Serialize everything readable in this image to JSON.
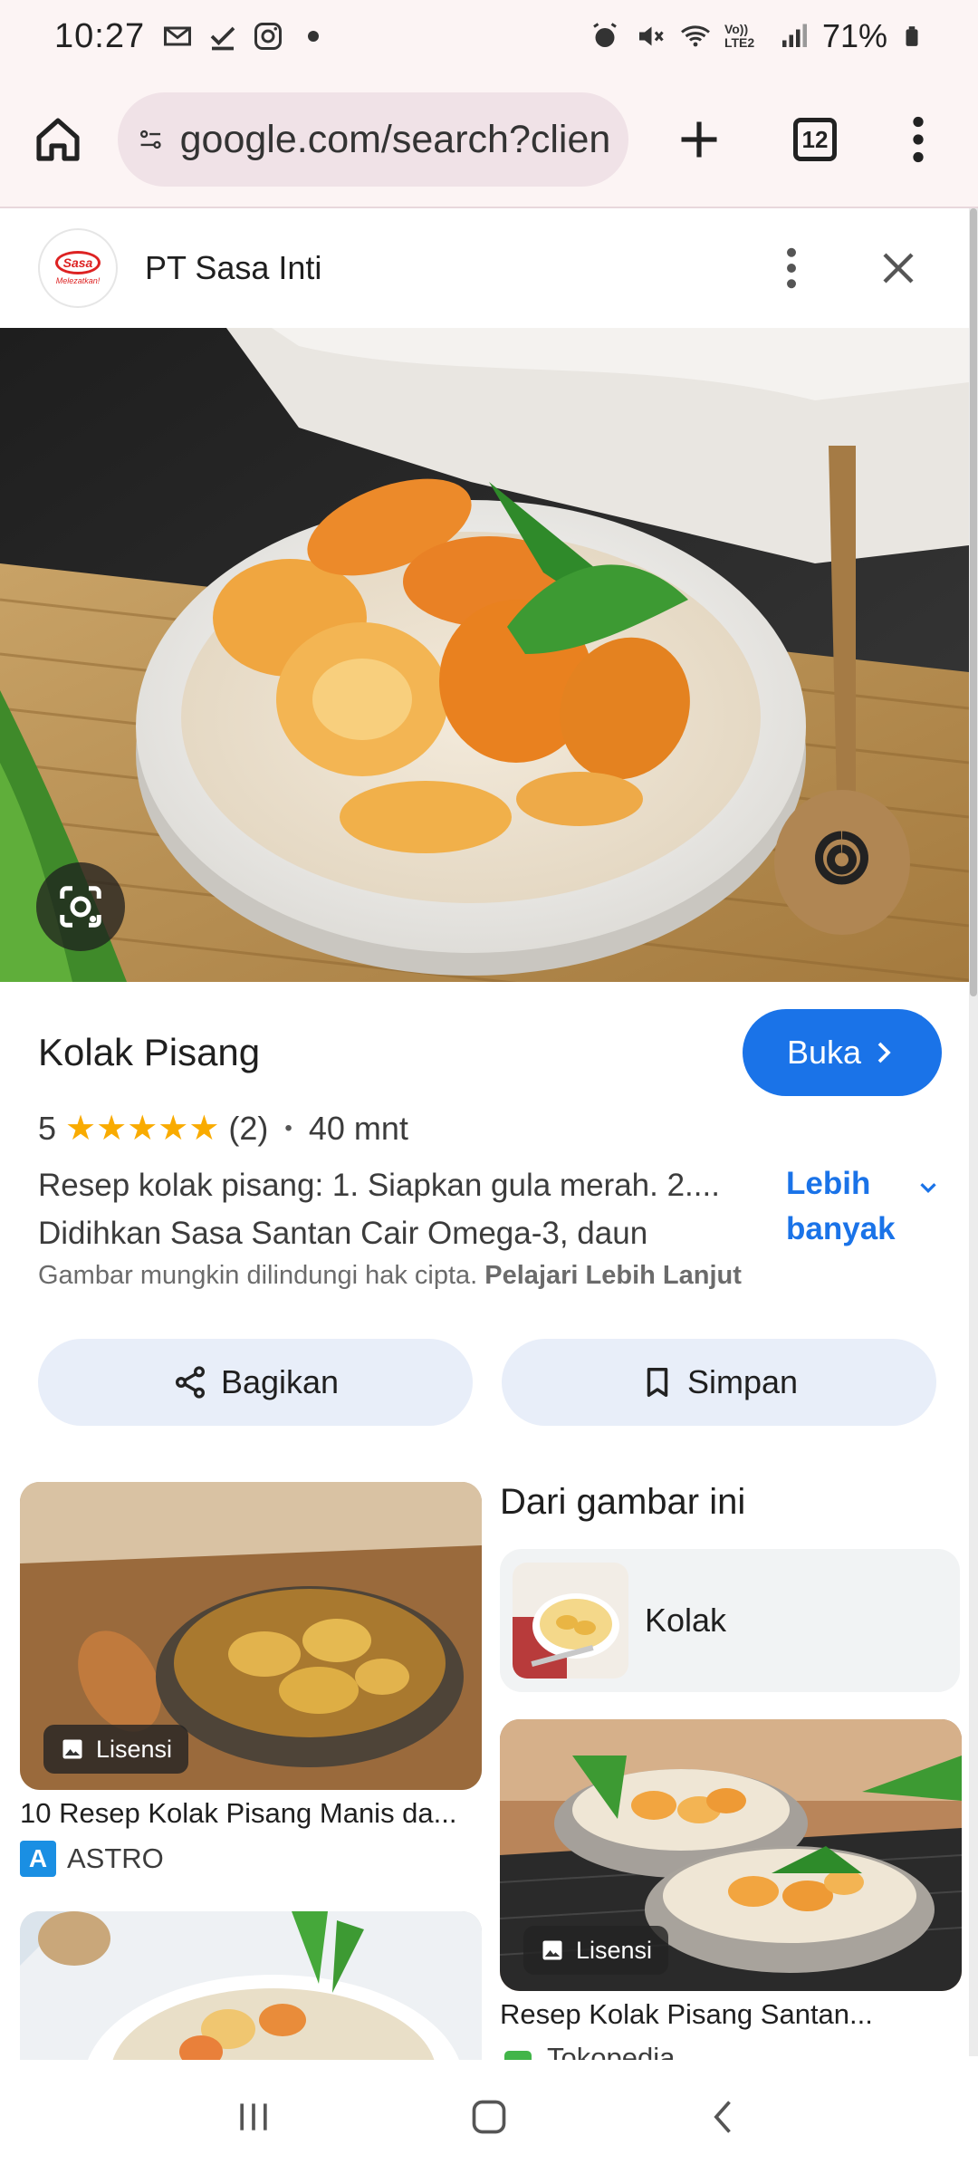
{
  "status_bar": {
    "time": "10:27",
    "battery": "71%",
    "left_icons": [
      "gmail-icon",
      "check-icon",
      "instagram-icon",
      "dot-icon"
    ],
    "right_icons": [
      "alarm-icon",
      "mute-icon",
      "wifi-icon",
      "volte-icon",
      "signal-icon",
      "battery-icon"
    ],
    "volte_label": "Vo)) LTE2"
  },
  "browser": {
    "url": "google.com/search?client=ms-android",
    "tab_count": "12"
  },
  "panel": {
    "source_name": "PT Sasa Inti",
    "logo_text": "Sasa",
    "logo_tagline": "Melezatkan!"
  },
  "recipe": {
    "title": "Kolak Pisang",
    "open_label": "Buka",
    "rating": "5",
    "stars": 5,
    "review_count": "(2)",
    "duration": "40 mnt",
    "snippet_line1": "Resep kolak pisang: 1. Siapkan gula merah. 2....",
    "snippet_line2": "Didihkan Sasa Santan Cair Omega-3, daun",
    "more_label_line1": "Lebih",
    "more_label_line2": "banyak",
    "copyright_text": "Gambar mungkin dilindungi hak cipta.",
    "copyright_link": "Pelajari Lebih Lanjut",
    "share_label": "Bagikan",
    "save_label": "Simpan"
  },
  "related": {
    "section_heading": "Dari gambar ini",
    "chip_label": "Kolak",
    "license_label": "Lisensi",
    "results": [
      {
        "title": "10 Resep Kolak Pisang Manis da...",
        "source": "ASTRO",
        "source_logo": "A"
      },
      {
        "title": "Resep Kolak Pisang Santan...",
        "source": "Tokopedia"
      }
    ]
  },
  "colors": {
    "accent": "#1a73e8",
    "star": "#f9ab00",
    "chip_bg": "#e8eef9",
    "browser_bg": "#fcf4f4"
  }
}
